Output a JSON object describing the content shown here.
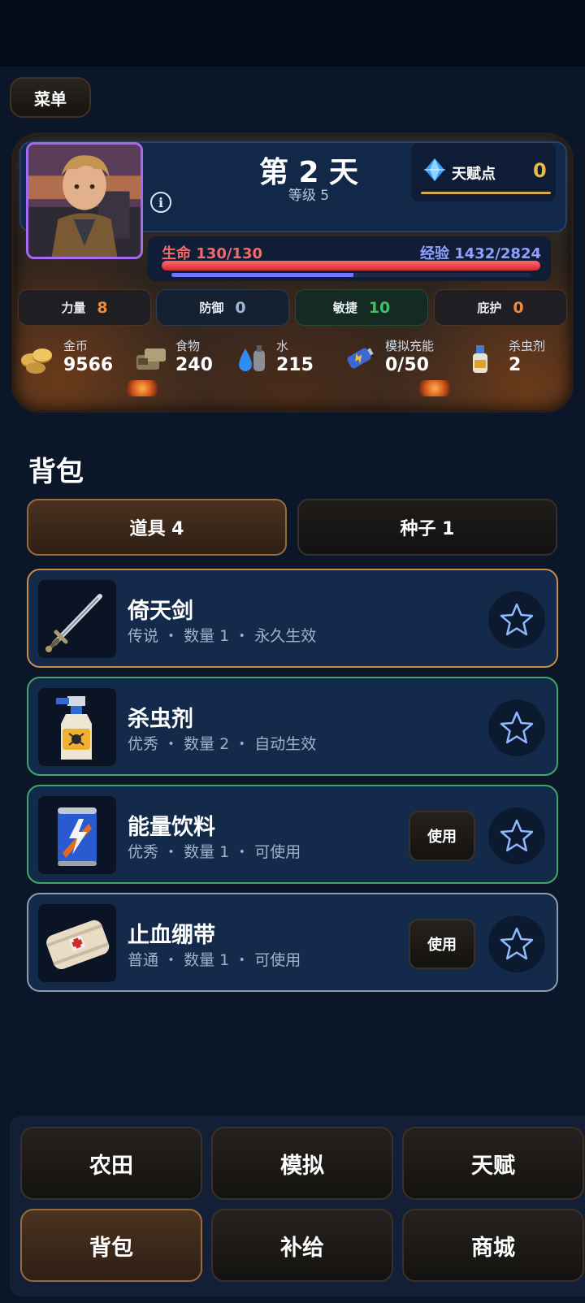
{
  "menu_label": "菜单",
  "status": {
    "day_title": "第 2 天",
    "level": "等级 5",
    "talent": {
      "label": "天赋点",
      "value": "0"
    },
    "hp": {
      "text": "生命 130/130",
      "current": 130,
      "max": 130
    },
    "xp": {
      "text": "经验 1432/2824",
      "current": 1432,
      "max": 2824
    },
    "stats": [
      {
        "label": "力量",
        "value": "8",
        "color": "#f08a3a"
      },
      {
        "label": "防御",
        "value": "0",
        "color": "#9ab4d4"
      },
      {
        "label": "敏捷",
        "value": "10",
        "color": "#3ec06a"
      },
      {
        "label": "庇护",
        "value": "0",
        "color": "#f08a3a"
      }
    ],
    "resources": [
      {
        "label": "金币",
        "value": "9566",
        "icon": "coins-icon"
      },
      {
        "label": "食物",
        "value": "240",
        "icon": "food-icon"
      },
      {
        "label": "水",
        "value": "215",
        "icon": "water-icon"
      },
      {
        "label": "模拟充能",
        "value": "0/50",
        "icon": "battery-icon"
      },
      {
        "label": "杀虫剂",
        "value": "2",
        "icon": "spray-icon"
      }
    ]
  },
  "backpack": {
    "title": "背包",
    "tabs": [
      {
        "label": "道具 4",
        "active": true
      },
      {
        "label": "种子 1",
        "active": false
      }
    ],
    "items": [
      {
        "name": "倚天剑",
        "meta": "传说 ・ 数量 1 ・ 永久生效",
        "icon": "sword-icon",
        "border": "#c98a4a",
        "use_label": ""
      },
      {
        "name": "杀虫剂",
        "meta": "优秀 ・ 数量 2 ・ 自动生效",
        "icon": "spray-icon",
        "border": "#3fa76a",
        "use_label": ""
      },
      {
        "name": "能量饮料",
        "meta": "优秀 ・ 数量 1 ・ 可使用",
        "icon": "energy-drink-icon",
        "border": "#3fa76a",
        "use_label": "使用"
      },
      {
        "name": "止血绷带",
        "meta": "普通 ・ 数量 1 ・ 可使用",
        "icon": "bandage-icon",
        "border": "#8a9ab0",
        "use_label": "使用"
      }
    ]
  },
  "nav": [
    {
      "label": "农田",
      "active": false
    },
    {
      "label": "模拟",
      "active": false
    },
    {
      "label": "天赋",
      "active": false
    },
    {
      "label": "背包",
      "active": true
    },
    {
      "label": "补给",
      "active": false
    },
    {
      "label": "商城",
      "active": false
    }
  ]
}
